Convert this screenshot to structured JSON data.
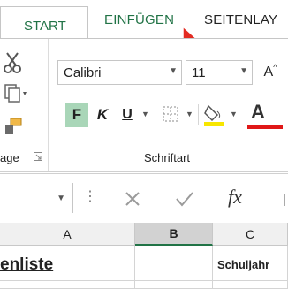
{
  "tabs": {
    "start": "START",
    "insert": "EINFÜGEN",
    "layout": "SEITENLAY"
  },
  "ribbon": {
    "font_name": "Calibri",
    "font_size": "11",
    "bold": "F",
    "italic": "K",
    "underline": "U",
    "grow_font": "A",
    "font_color_letter": "A",
    "clipboard_label": "age",
    "font_group_label": "Schriftart"
  },
  "formula_bar": {
    "fx": "fx",
    "colon": "⋮"
  },
  "grid": {
    "columns": [
      "A",
      "B",
      "C"
    ],
    "cell_a1": "enliste",
    "cell_c1": "Schuljahr"
  },
  "colors": {
    "accent": "#217346",
    "cursor": "#e32b22",
    "highlight_yellow": "#f7e600",
    "font_red": "#e01818",
    "selected_header": "#d2d2d2",
    "bold_bg": "#a9d6b8"
  }
}
